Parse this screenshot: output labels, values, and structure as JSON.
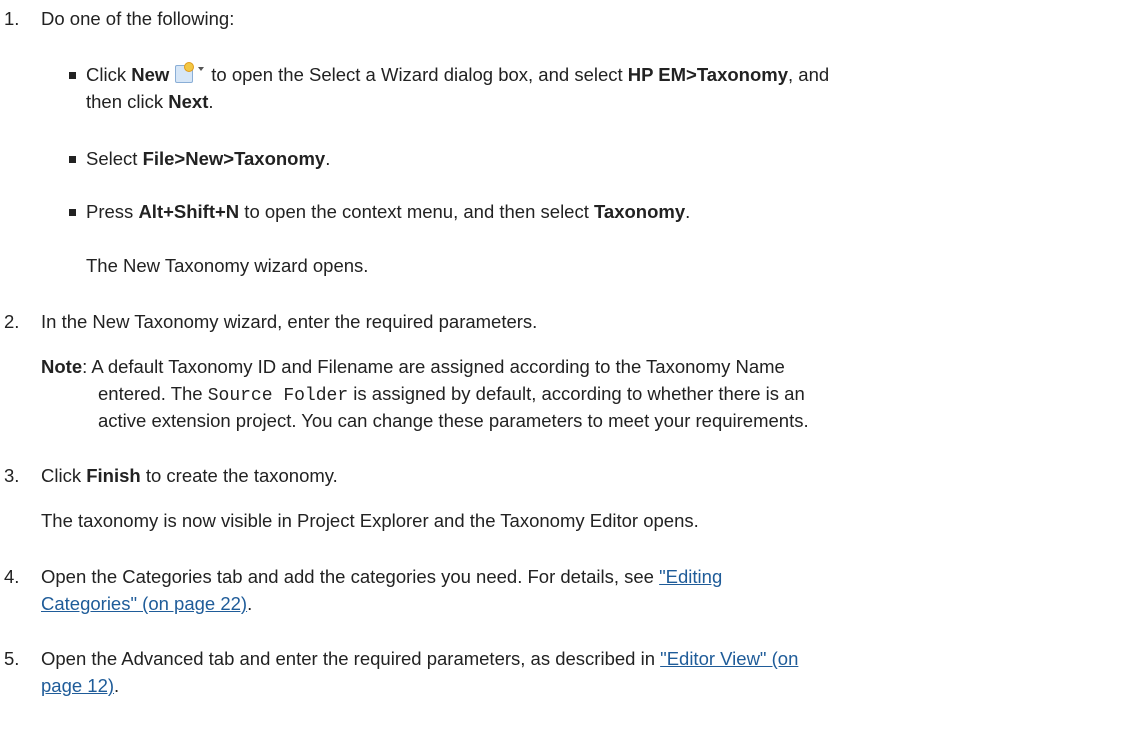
{
  "steps": [
    {
      "number": "1.",
      "text": "Do one of the following:"
    },
    {
      "number": "2.",
      "text": "In the New Taxonomy wizard, enter the required parameters."
    },
    {
      "number": "3.",
      "pre": "Click ",
      "bold": "Finish",
      "post": " to create the taxonomy."
    },
    {
      "number": "4.",
      "text": "Open the Categories tab and add the categories you need. For details, see ",
      "link_line1": "\"Editing",
      "link_line2": "Categories\" (on page 22)",
      "post": "."
    },
    {
      "number": "5.",
      "text": "Open the Advanced tab and enter the required parameters, as described in ",
      "link_line1": "\"Editor View\" (on",
      "link_line2": "page 12)",
      "post": "."
    }
  ],
  "options": [
    {
      "pre": "Click ",
      "bold1": "New",
      "icon": "new-wizard-icon",
      "mid": "to open the Select a Wizard dialog box, and select ",
      "bold2": "HP EM>Taxonomy",
      "post": ", and",
      "line2_pre": "then click ",
      "line2_bold": "Next",
      "line2_post": "."
    },
    {
      "pre": "Select ",
      "bold1": "File>New>Taxonomy",
      "post": "."
    },
    {
      "pre": "Press ",
      "bold1": "Alt+Shift+N",
      "mid": " to open the context menu, and then select ",
      "bold2": "Taxonomy",
      "post": "."
    }
  ],
  "wizard_opens": "The New Taxonomy wizard opens.",
  "note": {
    "label": "Note",
    "line1": ": A default Taxonomy ID and Filename are assigned according to the Taxonomy Name",
    "line2_pre": "entered. The ",
    "code": "Source Folder",
    "line2_post": " is assigned by default, according to whether there is an",
    "line3": "active extension project. You can change these parameters to meet your requirements."
  },
  "step3_result": "The taxonomy is now visible in Project Explorer and the Taxonomy Editor opens.",
  "colors": {
    "text": "#222222",
    "link": "#1f5c99"
  }
}
